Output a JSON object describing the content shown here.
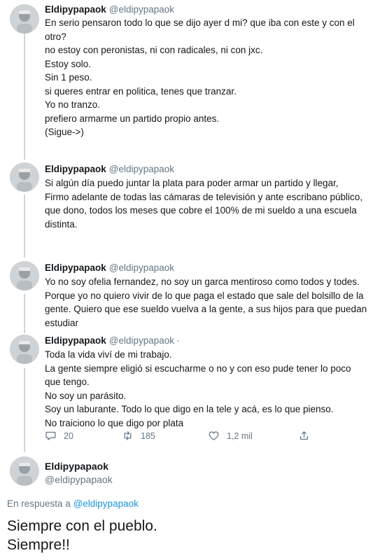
{
  "tweets": [
    {
      "name": "Eldipypapaok",
      "handle": "@eldipypapaok",
      "lines": [
        "En serio pensaron todo lo que se dijo ayer d mi? que iba con este y con el",
        "otro?",
        "no estoy con peronistas, ni con radicales, ni con jxc.",
        "Estoy solo.",
        "Sin 1 peso.",
        "si queres entrar en politica, tenes que tranzar.",
        "Yo no tranzo.",
        "prefiero armarme un partido propio antes.",
        "(Sigue->)"
      ]
    },
    {
      "name": "Eldipypapaok",
      "handle": "@eldipypapaok",
      "lines": [
        "Si algún día puedo juntar la plata para poder armar un partido y llegar,",
        "Firmo adelante de todas las cámaras de televisión y ante escribano público,",
        "que dono, todos los meses que cobre el 100% de mi sueldo a una escuela",
        "distinta."
      ]
    },
    {
      "name": "Eldipypapaok",
      "handle": "@eldipypapaok",
      "lines": [
        "Yo no soy ofelia fernandez, no soy un garca mentiroso como todos y todes.",
        "Porque yo no quiero vivir de lo que paga el estado que sale del bolsillo de la",
        "gente. Quiero que ese sueldo vuelva a la gente, a sus hijos para que puedan",
        "estudiar"
      ]
    },
    {
      "name": "Eldipypapaok",
      "handle": "@eldipypapaok",
      "dot": "·",
      "lines": [
        "Toda la vida viví de mi trabajo.",
        "La gente siempre eligió si escucharme o no y con eso pude tener lo poco",
        "que tengo.",
        "No soy un parásito.",
        "Soy un laburante. Todo lo que digo en la tele y acá, es lo que pienso.",
        "No traiciono lo que digo por plata"
      ],
      "actions": {
        "reply_count": "20",
        "retweet_count": "185",
        "like_count": "1,2 mil"
      }
    }
  ],
  "last_tweet": {
    "name": "Eldipypapaok",
    "handle": "@eldipypapaok",
    "reply_prefix": "En respuesta a",
    "reply_handle": "@eldipypapaok",
    "lines": [
      "Siempre con el pueblo.",
      "Siempre!!"
    ]
  },
  "icons": {
    "reply": "speech-bubble-icon",
    "retweet": "retweet-arrows-icon",
    "like": "heart-icon",
    "share": "share-upload-icon"
  }
}
